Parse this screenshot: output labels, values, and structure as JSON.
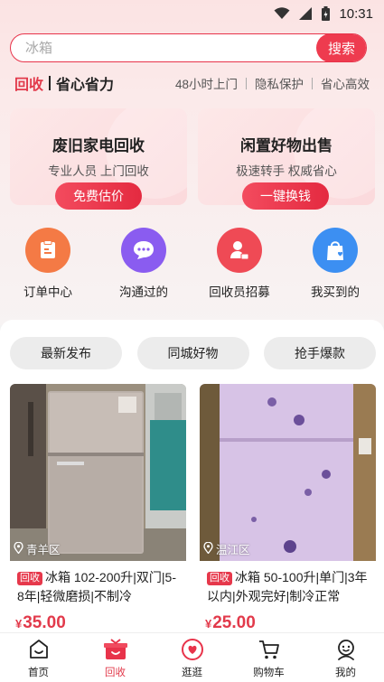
{
  "status_bar": {
    "time": "10:31"
  },
  "search": {
    "placeholder": "冰箱",
    "button": "搜索"
  },
  "slogan": {
    "brand": "回收",
    "tagline": "省心省力",
    "features": [
      "48小时上门",
      "隐私保护",
      "省心高效"
    ]
  },
  "cards": [
    {
      "title": "废旧家电回收",
      "subtitle": "专业人员 上门回收",
      "button": "免费估价"
    },
    {
      "title": "闲置好物出售",
      "subtitle": "极速转手 权威省心",
      "button": "一键换钱"
    }
  ],
  "quick_links": [
    {
      "label": "订单中心",
      "icon": "order-icon",
      "color": "#f47a45"
    },
    {
      "label": "沟通过的",
      "icon": "chat-icon",
      "color": "#8a5cf0"
    },
    {
      "label": "回收员招募",
      "icon": "recruit-icon",
      "color": "#ef4a55"
    },
    {
      "label": "我买到的",
      "icon": "bag-icon",
      "color": "#3c8ff2"
    }
  ],
  "filters": [
    "最新发布",
    "同城好物",
    "抢手爆款"
  ],
  "products": [
    {
      "location": "青羊区",
      "tag": "回收",
      "title": "冰箱 102-200升|双门|5-8年|轻微磨损|不制冷",
      "currency": "¥",
      "price": "35.00"
    },
    {
      "location": "温江区",
      "tag": "回收",
      "title": "冰箱 50-100升|单门|3年以内|外观完好|制冷正常",
      "currency": "¥",
      "price": "25.00"
    }
  ],
  "tabbar": [
    {
      "label": "首页",
      "icon": "home-icon",
      "active": false
    },
    {
      "label": "回收",
      "icon": "recycle-gift-icon",
      "active": true
    },
    {
      "label": "逛逛",
      "icon": "browse-heart-icon",
      "active": false
    },
    {
      "label": "购物车",
      "icon": "cart-icon",
      "active": false
    },
    {
      "label": "我的",
      "icon": "profile-icon",
      "active": false
    }
  ],
  "colors": {
    "accent": "#e8334a",
    "card_bg": "#fbdfe1"
  }
}
